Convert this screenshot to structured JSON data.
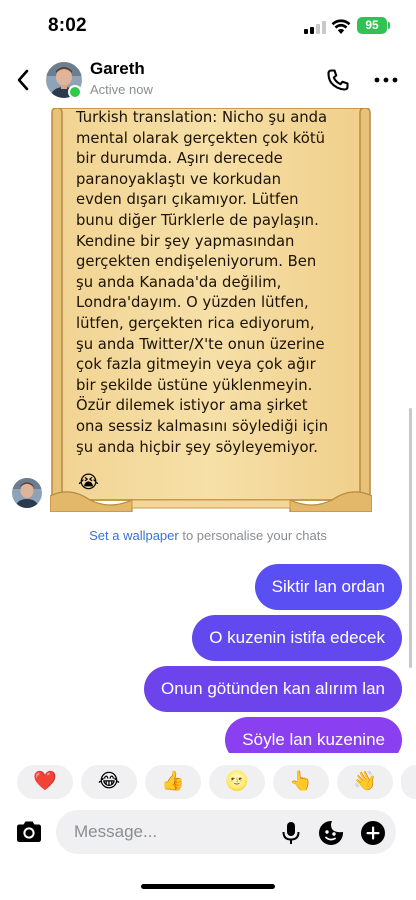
{
  "status_bar": {
    "time": "8:02",
    "battery": "95",
    "signal_bars_active": 2,
    "battery_color": "#30c252"
  },
  "header": {
    "contact_name": "Gareth",
    "contact_status": "Active now",
    "online_color": "#31c94a",
    "icons": [
      "back-icon",
      "avatar",
      "phone-icon",
      "more-icon"
    ]
  },
  "chat": {
    "incoming_image": {
      "type": "parchment-scroll",
      "lines": [
        "Turkish translation: Nicho şu anda",
        "mental olarak gerçekten çok kötü",
        "bir durumda. Aşırı derecede",
        "paranoyaklaştı ve korkudan",
        "evden dışarı çıkamıyor. Lütfen",
        "bunu diğer Türklerle de paylaşın.",
        "Kendine bir şey yapmasından",
        "gerçekten endişeleniyorum. Ben",
        "şu anda Kanada'da değilim,",
        "Londra'dayım. O yüzden lütfen,",
        "lütfen, gerçekten rica ediyorum,",
        "şu anda Twitter/X'te onun üzerine",
        "çok fazla gitmeyin veya çok ağır",
        "bir şekilde üstüne yüklenmeyin.",
        "Özür dilemek istiyor ama şirket",
        "ona sessiz kalmasını söylediği için",
        "şu anda hiçbir şey söyleyemiyor."
      ],
      "emoji": "😭"
    },
    "wallpaper_note": {
      "link": "Set a wallpaper",
      "text": " to personalise your chats"
    },
    "outgoing": [
      "Siktir lan ordan",
      "O kuzenin istifa edecek",
      "Onun götünden kan alırım lan",
      "Söyle lan kuzenine"
    ],
    "bubble_colors": [
      "#5a4ff2",
      "#6149ef",
      "#6d44ec",
      "#8a3ff0"
    ]
  },
  "reactions": [
    "❤️",
    "😂",
    "👍",
    "🌝",
    "👆",
    "👋"
  ],
  "composer": {
    "placeholder": "Message...",
    "value": ""
  }
}
